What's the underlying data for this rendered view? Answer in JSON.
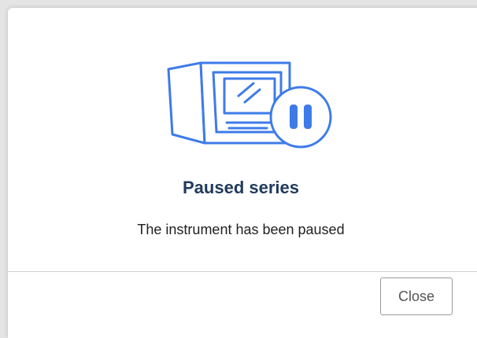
{
  "dialog": {
    "icon": "paused-instrument-icon",
    "title": "Paused series",
    "message": "The instrument has been paused",
    "close_label": "Close"
  },
  "colors": {
    "accent": "#3e7be8",
    "title": "#203a5c",
    "background": "#ffffff",
    "overlay": "#e4e4e4"
  }
}
